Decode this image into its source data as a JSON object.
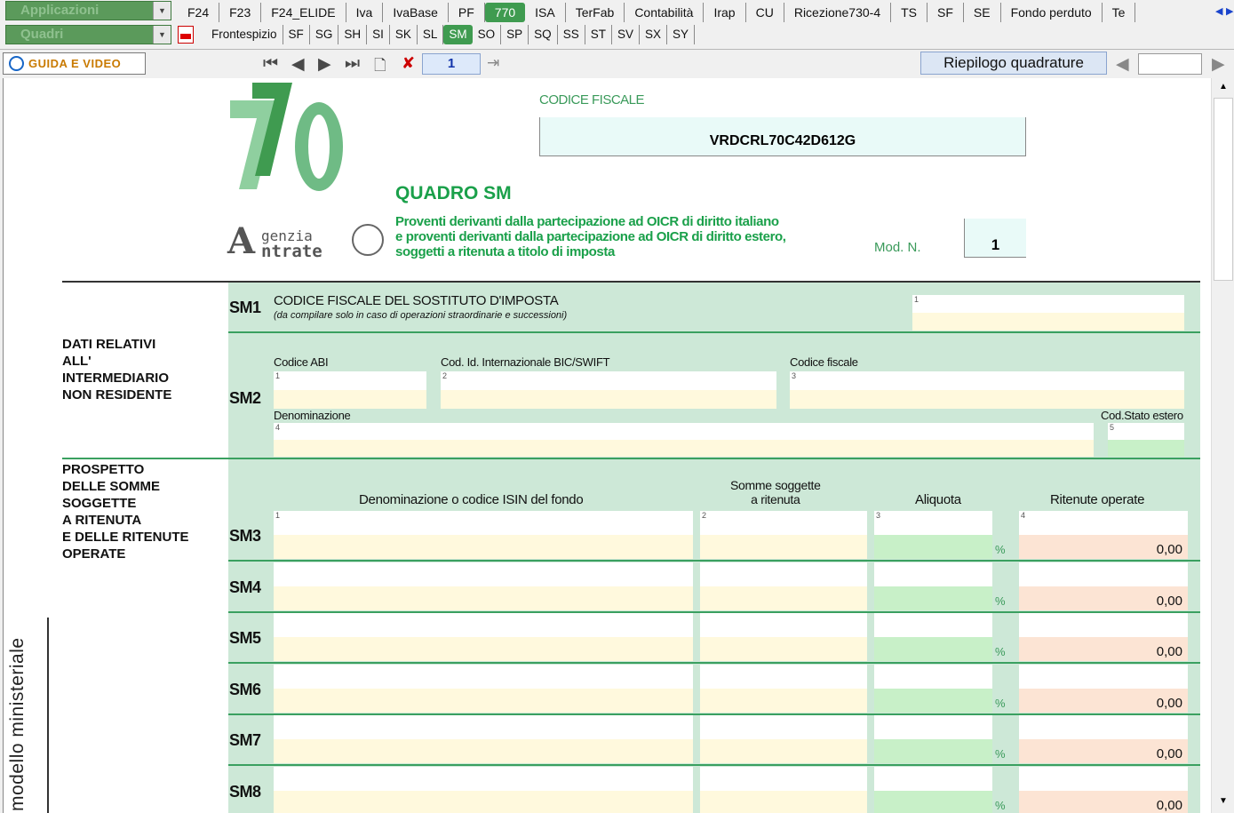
{
  "top": {
    "app_combo": "Applicazioni",
    "quadri_combo": "Quadri",
    "tabs_row1": [
      "F24",
      "F23",
      "F24_ELIDE",
      "Iva",
      "IvaBase",
      "PF",
      "770",
      "ISA",
      "TerFab",
      "Contabilità",
      "Irap",
      "CU",
      "Ricezione730-4",
      "TS",
      "SF",
      "SE",
      "Fondo perduto",
      "Te"
    ],
    "active_row1": "770",
    "tabs_row2": [
      "Frontespizio",
      "SF",
      "SG",
      "SH",
      "SI",
      "SK",
      "SL",
      "SM",
      "SO",
      "SP",
      "SQ",
      "SS",
      "ST",
      "SV",
      "SX",
      "SY"
    ],
    "active_row2": "SM"
  },
  "toolbar": {
    "guida_label": "GUIDA E VIDEO",
    "page_number": "1",
    "riepilogo_label": "Riepilogo quadrature"
  },
  "form": {
    "codice_fiscale_label": "CODICE FISCALE",
    "codice_fiscale_value": "VRDCRL70C42D612G",
    "quadro_title": "QUADRO SM",
    "subtitle_line1": "Proventi derivanti dalla partecipazione ad OICR di diritto italiano",
    "subtitle_line2": "e proventi derivanti dalla partecipazione ad OICR di diritto estero,",
    "subtitle_line3": "soggetti a ritenuta a titolo di imposta",
    "mod_n_label": "Mod. N.",
    "mod_n_value": "1",
    "logo_big": "770",
    "agenzia_line1": "genzia",
    "agenzia_line2": "ntrate",
    "side_label": "modello ministeriale",
    "sm1": {
      "code": "SM1",
      "title": "CODICE FISCALE DEL SOSTITUTO D'IMPOSTA",
      "note": "(da compilare solo in caso di operazioni straordinarie e successioni)"
    },
    "sezione_intermediario": {
      "title_lines": [
        "DATI RELATIVI",
        "ALL'",
        "INTERMEDIARIO",
        "NON RESIDENTE"
      ],
      "code": "SM2",
      "codice_abi": "Codice ABI",
      "bic": "Cod. Id. Internazionale BIC/SWIFT",
      "codice_fiscale": "Codice fiscale",
      "denominazione": "Denominazione",
      "cod_stato": "Cod.Stato estero"
    },
    "prospetto": {
      "title_lines": [
        "PROSPETTO",
        "DELLE SOMME",
        "SOGGETTE",
        "A RITENUTA",
        "E DELLE RITENUTE",
        "OPERATE"
      ],
      "col_denominazione": "Denominazione o codice ISIN del fondo",
      "col_somme_1": "Somme soggette",
      "col_somme_2": "a ritenuta",
      "col_aliquota": "Aliquota",
      "col_ritenute": "Ritenute operate",
      "rows": [
        {
          "code": "SM3",
          "ritenute": "0,00"
        },
        {
          "code": "SM4",
          "ritenute": "0,00"
        },
        {
          "code": "SM5",
          "ritenute": "0,00"
        },
        {
          "code": "SM6",
          "ritenute": "0,00"
        },
        {
          "code": "SM7",
          "ritenute": "0,00"
        },
        {
          "code": "SM8",
          "ritenute": "0,00"
        }
      ]
    }
  },
  "colors": {
    "accent_green": "#3f9b50",
    "form_green": "#cde8d7",
    "title_green": "#1aa04a"
  }
}
